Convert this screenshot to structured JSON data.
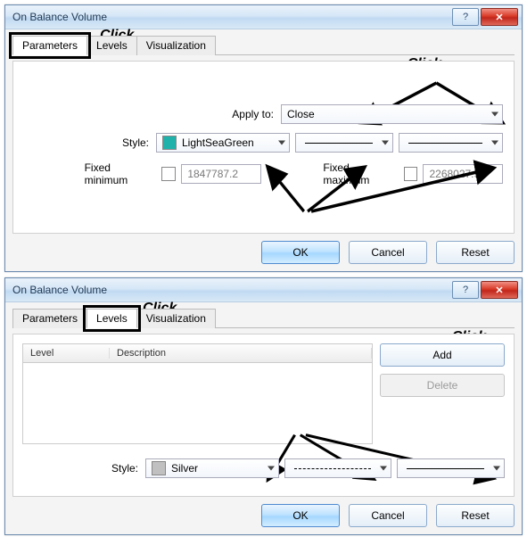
{
  "dialog1": {
    "title": "On Balance Volume",
    "tabs": [
      "Parameters",
      "Levels",
      "Visualization"
    ],
    "active_tab": 0,
    "apply_label": "Apply to:",
    "apply_value": "Close",
    "style_label": "Style:",
    "style_color_name": "LightSeaGreen",
    "style_color_hex": "#20B2AA",
    "fixed_min_label": "Fixed minimum",
    "fixed_min_value": "1847787.2",
    "fixed_max_label": "Fixed maximum",
    "fixed_max_value": "2268027.9",
    "buttons": {
      "ok": "OK",
      "cancel": "Cancel",
      "reset": "Reset"
    }
  },
  "dialog2": {
    "title": "On Balance Volume",
    "tabs": [
      "Parameters",
      "Levels",
      "Visualization"
    ],
    "active_tab": 1,
    "table_headers": [
      "Level",
      "Description"
    ],
    "add_label": "Add",
    "delete_label": "Delete",
    "style_label": "Style:",
    "style_color_name": "Silver",
    "style_color_hex": "#C0C0C0",
    "buttons": {
      "ok": "OK",
      "cancel": "Cancel",
      "reset": "Reset"
    }
  },
  "annotations": {
    "click": "Click"
  },
  "titlebar_icons": {
    "help": "?",
    "close": "✕"
  }
}
